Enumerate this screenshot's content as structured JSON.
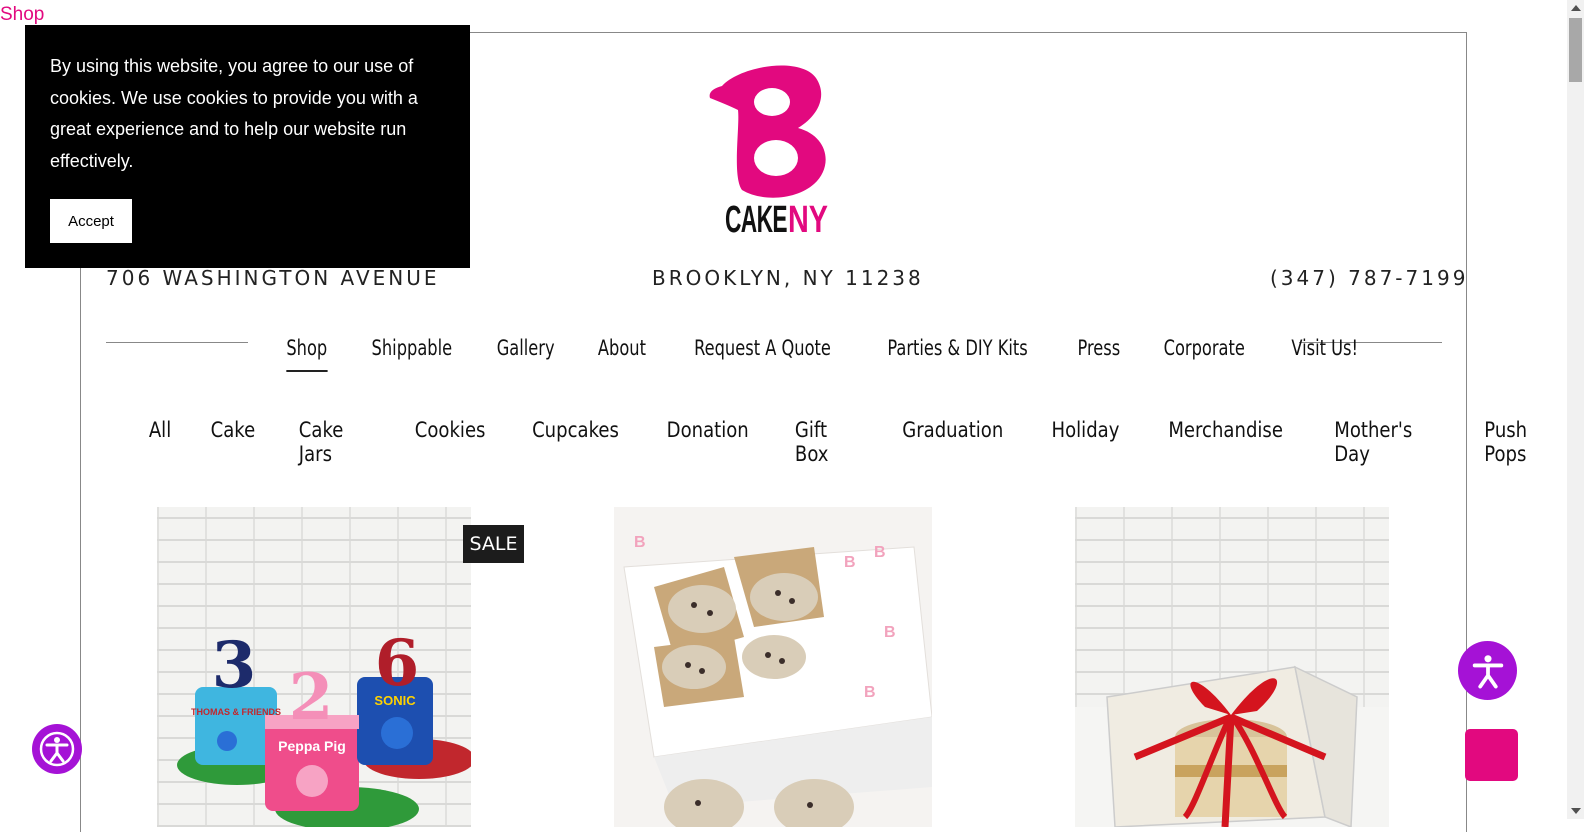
{
  "skip_link": "Shop",
  "brand": {
    "logo_letter": "B",
    "logo_word_1": "CAKE",
    "logo_word_2": "NY",
    "pink": "#e2097f"
  },
  "contact": {
    "address": "706 WASHINGTON AVENUE",
    "city": "BROOKLYN, NY 11238",
    "phone": "(347) 787-7199"
  },
  "main_nav": [
    {
      "label": "Shop",
      "active": true
    },
    {
      "label": "Shippable"
    },
    {
      "label": "Gallery"
    },
    {
      "label": "About"
    },
    {
      "label": "Request A Quote"
    },
    {
      "label": "Parties & DIY Kits"
    },
    {
      "label": "Press"
    },
    {
      "label": "Corporate"
    },
    {
      "label": "Visit Us!"
    }
  ],
  "categories": [
    "All",
    "Cake",
    "Cake Jars",
    "Cookies",
    "Cupcakes",
    "Donation",
    "Gift Box",
    "Graduation",
    "Holiday",
    "Merchandise",
    "Mother's Day",
    "Push Pops"
  ],
  "products": [
    {
      "badge": "SALE",
      "cake_numbers": [
        "3",
        "2",
        "6"
      ],
      "cake_labels": [
        "THOMAS & FRIENDS",
        "Peppa Pig",
        "SONIC"
      ]
    },
    {},
    {}
  ],
  "cookie_banner": {
    "text": "By using this website, you agree to our use of cookies. We use cookies to provide you with a great experience and to help our website run effectively.",
    "accept_label": "Accept"
  },
  "colors": {
    "accessibility": "#a512d6",
    "scroll_top": "#e2097f"
  },
  "icons": [
    "accessibility-icon",
    "accessibility-icon",
    "scroll-to-top-button"
  ]
}
